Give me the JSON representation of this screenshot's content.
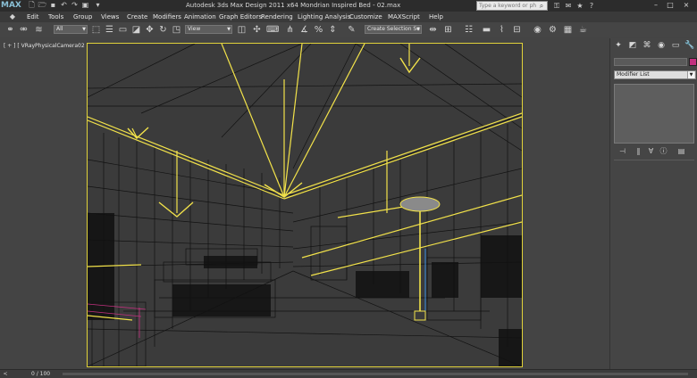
{
  "window": {
    "title": "Autodesk 3ds Max Design 2011 x64     Mondrian Inspired Bed - 02.max",
    "app_logo": "MAX",
    "search_placeholder": "Type a keyword or phrase"
  },
  "quick_access": [
    {
      "name": "new-file-icon",
      "glyph": "🗋"
    },
    {
      "name": "open-file-icon",
      "glyph": "🗁"
    },
    {
      "name": "save-file-icon",
      "glyph": "💾"
    },
    {
      "name": "undo-icon",
      "glyph": "↶"
    },
    {
      "name": "redo-icon",
      "glyph": "↷"
    },
    {
      "name": "hold-icon",
      "glyph": "▣"
    },
    {
      "name": "quick-access-dropdown-icon",
      "glyph": "▾"
    }
  ],
  "title_tools": [
    {
      "name": "search-go-icon",
      "glyph": "🔍"
    },
    {
      "name": "subscription-icon",
      "glyph": "⚿"
    },
    {
      "name": "communication-center-icon",
      "glyph": "✉"
    },
    {
      "name": "favorites-icon",
      "glyph": "★"
    },
    {
      "name": "help-icon",
      "glyph": "?"
    }
  ],
  "window_controls": {
    "minimize": "–",
    "maximize": "□",
    "close": "×"
  },
  "menu": {
    "logo": "◆",
    "items": [
      "Edit",
      "Tools",
      "Group",
      "Views",
      "Create",
      "Modifiers",
      "Animation",
      "Graph Editors",
      "Rendering",
      "Lighting Analysis",
      "Customize",
      "MAXScript",
      "Help"
    ]
  },
  "toolbar": {
    "selection_filter": "All",
    "reference_coord": "View",
    "named_selection": "Create Selection Se",
    "icons": [
      "select-and-link-icon",
      "unlink-icon",
      "bind-space-warp-icon",
      "select-object-icon",
      "select-by-name-icon",
      "rectangular-selection-icon",
      "window-crossing-icon",
      "select-and-move-icon",
      "select-and-rotate-icon",
      "select-and-scale-icon",
      "pivot-center-icon",
      "select-and-manipulate-icon",
      "keyboard-shortcut-icon",
      "snaps-toggle-icon",
      "angle-snap-icon",
      "percent-snap-icon",
      "spinner-snap-icon",
      "edit-named-selection-icon",
      "mirror-icon",
      "align-icon",
      "layer-manager-icon",
      "graphite-toggle-icon",
      "curve-editor-icon",
      "schematic-view-icon",
      "material-editor-icon",
      "render-setup-icon",
      "rendered-frame-icon",
      "render-icon",
      "render-iterative-icon",
      "active-shade-icon"
    ]
  },
  "viewport": {
    "label": "[ + ] [ VRayPhysicalCamera02 ] [ Wireframe + Edged Faces ]",
    "border_color": "#e0d23a",
    "selection_color": "#f2e24a",
    "wire_color": "#111111"
  },
  "command_panel": {
    "tabs": [
      "create-tab-icon",
      "modify-tab-icon",
      "hierarchy-tab-icon",
      "motion-tab-icon",
      "display-tab-icon",
      "utilities-tab-icon"
    ],
    "tab_glyphs": [
      "✦",
      "◩",
      "⌘",
      "◉",
      "▭",
      "🔧"
    ],
    "object_color": "#c2307e",
    "modifier_list": "Modifier List",
    "stack_buttons": [
      "pin-stack-icon",
      "show-end-result-icon",
      "make-unique-icon",
      "remove-modifier-icon",
      "configure-modifier-sets-icon"
    ],
    "stack_glyphs": [
      "⊣",
      "‖",
      "∀",
      "ⓘ",
      "▤"
    ]
  },
  "status": {
    "frame_counter": "0 / 100",
    "time_slider_prev": "<"
  }
}
